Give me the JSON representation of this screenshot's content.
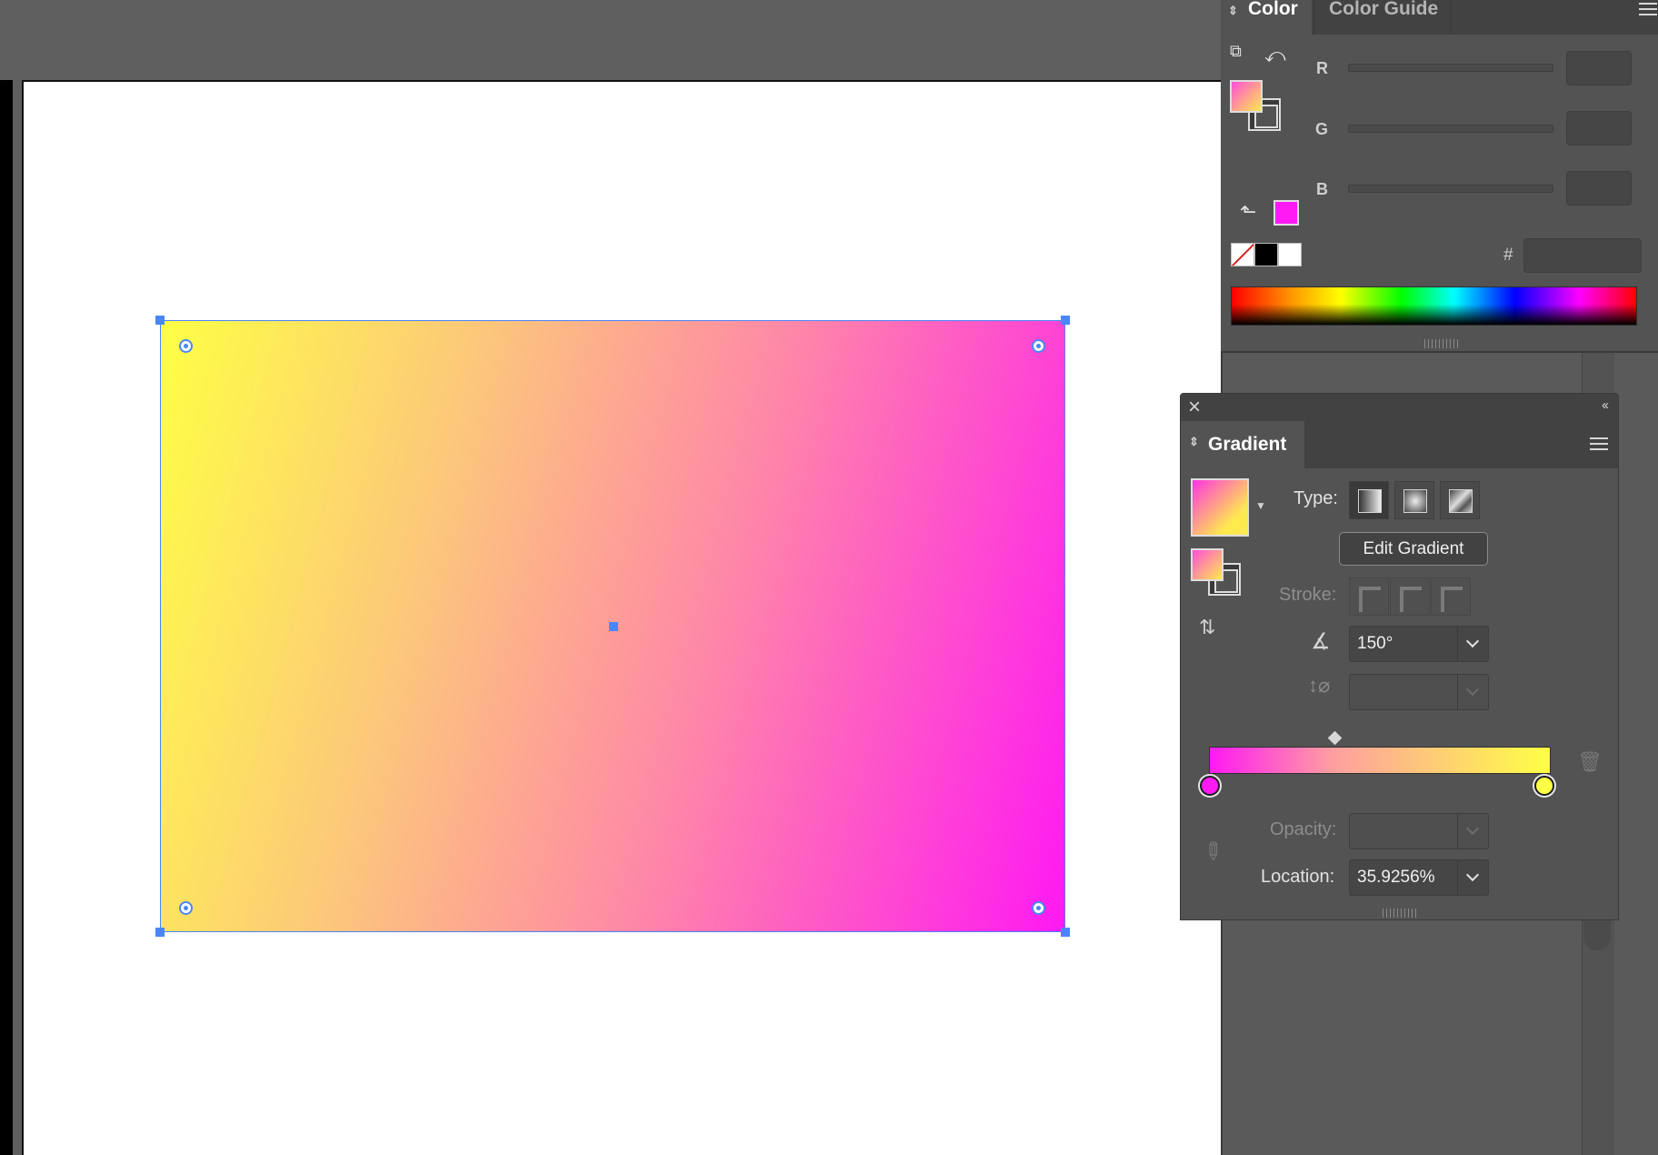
{
  "color_panel": {
    "tabs": [
      "Color",
      "Color Guide"
    ],
    "channels": [
      "R",
      "G",
      "B"
    ],
    "hex_label": "#",
    "last_color": "#ff19f2"
  },
  "gradient_panel": {
    "title": "Gradient",
    "type_label": "Type:",
    "edit_button": "Edit Gradient",
    "stroke_label": "Stroke:",
    "angle_value": "150°",
    "opacity_label": "Opacity:",
    "location_label": "Location:",
    "location_value": "35.9256%",
    "stops": [
      {
        "color": "#ff19f2",
        "location": 0
      },
      {
        "color": "#ffff45",
        "location": 1
      }
    ],
    "midpoint_location": 0.359256
  },
  "canvas": {
    "gradient_from": "#ffff45",
    "gradient_to": "#ff19f2",
    "selection_color": "#4a86f7"
  }
}
